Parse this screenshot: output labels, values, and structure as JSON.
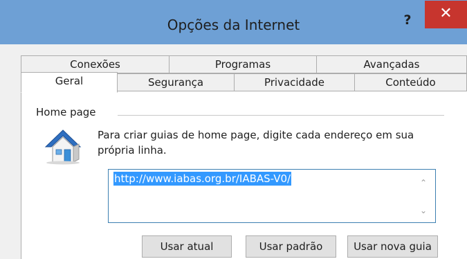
{
  "window": {
    "title": "Opções da Internet",
    "help_label": "?",
    "close_label": "✕"
  },
  "tabs": {
    "back_row": [
      "Conexões",
      "Programas",
      "Avançadas"
    ],
    "front_row": [
      "Geral",
      "Segurança",
      "Privacidade",
      "Conteúdo"
    ],
    "selected": "Geral"
  },
  "home_page": {
    "group_label": "Home page",
    "description": "Para criar guias de home page, digite cada endereço em sua própria linha.",
    "url_value": "http://www.iabas.org.br/IABAS-V0/",
    "icon": "house-icon"
  },
  "buttons": {
    "use_current": "Usar atual",
    "use_default": "Usar padrão",
    "use_new_tab": "Usar nova guia"
  },
  "colors": {
    "titlebar": "#6ea0d5",
    "close_button": "#c7352e",
    "selection": "#3399ff"
  }
}
